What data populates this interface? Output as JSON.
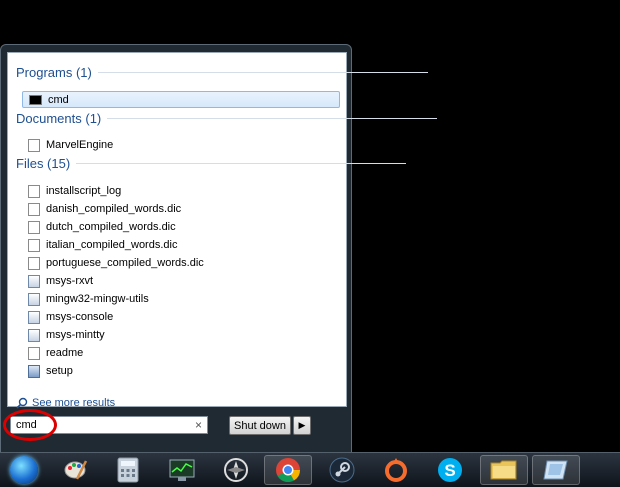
{
  "start_menu": {
    "groups": [
      {
        "header": "Programs (1)",
        "items": [
          {
            "label": "cmd",
            "icon": "command-prompt-icon"
          }
        ]
      },
      {
        "header": "Documents (1)",
        "items": [
          {
            "label": "MarvelEngine",
            "icon": "document-icon"
          }
        ]
      },
      {
        "header": "Files (15)",
        "items": [
          {
            "label": "installscript_log",
            "icon": "document-icon"
          },
          {
            "label": "danish_compiled_words.dic",
            "icon": "document-icon"
          },
          {
            "label": "dutch_compiled_words.dic",
            "icon": "document-icon"
          },
          {
            "label": "italian_compiled_words.dic",
            "icon": "document-icon"
          },
          {
            "label": "portuguese_compiled_words.dic",
            "icon": "document-icon"
          },
          {
            "label": "msys-rxvt",
            "icon": "application-icon"
          },
          {
            "label": "mingw32-mingw-utils",
            "icon": "application-icon"
          },
          {
            "label": "msys-console",
            "icon": "application-icon"
          },
          {
            "label": "msys-mintty",
            "icon": "application-icon"
          },
          {
            "label": "readme",
            "icon": "document-icon"
          },
          {
            "label": "setup",
            "icon": "setup-icon"
          }
        ]
      }
    ],
    "see_more": "See more results",
    "search_value": "cmd",
    "clear_icon": "×",
    "shutdown_label": "Shut down",
    "shutdown_arrow": "▶"
  },
  "taskbar": {
    "items": [
      "start-orb-icon",
      "paint-icon",
      "calculator-icon",
      "system-monitor-icon",
      "media-player-icon",
      "chrome-icon",
      "steam-icon",
      "origin-icon",
      "skype-icon",
      "file-explorer-icon",
      "generic-app-icon"
    ]
  },
  "colors": {
    "accent": "#1e4f91",
    "highlight_ring": "#dd0000"
  }
}
